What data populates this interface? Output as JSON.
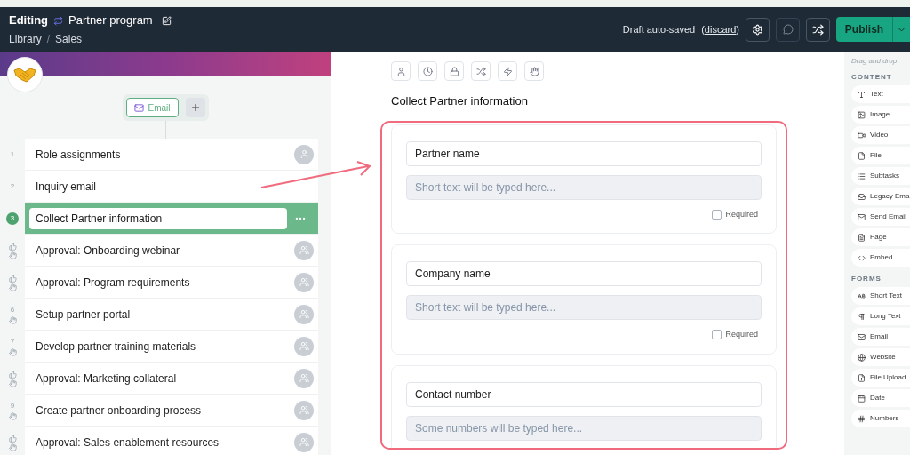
{
  "header": {
    "mode": "Editing",
    "title": "Partner program",
    "breadcrumb": [
      "Library",
      "Sales"
    ],
    "breadcrumb_separator": "/",
    "save_status": "Draft auto-saved",
    "discard_open": "(",
    "discard_link": "discard",
    "discard_close": ")",
    "publish_button": "Publish"
  },
  "workflow": {
    "trigger_chip": "Email",
    "steps": [
      {
        "number": "1",
        "approval": false,
        "manual": false,
        "label": "Role assignments",
        "kind": "person",
        "selected": false
      },
      {
        "number": "2",
        "approval": false,
        "manual": false,
        "label": "Inquiry email",
        "kind": "plain",
        "selected": false
      },
      {
        "number": "3",
        "approval": false,
        "manual": false,
        "label": "Collect Partner information",
        "kind": "plain",
        "selected": true
      },
      {
        "approval": true,
        "manual": true,
        "label": "Approval: Onboarding webinar",
        "kind": "group",
        "selected": false
      },
      {
        "approval": true,
        "manual": true,
        "label": "Approval: Program requirements",
        "kind": "group",
        "selected": false
      },
      {
        "number": "6",
        "approval": false,
        "manual": true,
        "label": "Setup partner portal",
        "kind": "group",
        "selected": false
      },
      {
        "number": "7",
        "approval": false,
        "manual": true,
        "label": "Develop partner training materials",
        "kind": "group",
        "selected": false
      },
      {
        "approval": true,
        "manual": true,
        "label": "Approval: Marketing collateral",
        "kind": "group",
        "selected": false
      },
      {
        "number": "9",
        "approval": false,
        "manual": true,
        "label": "Create partner onboarding process",
        "kind": "group",
        "selected": false
      },
      {
        "approval": true,
        "manual": true,
        "label": "Approval: Sales enablement resources",
        "kind": "group",
        "selected": false
      }
    ]
  },
  "editor": {
    "title": "Collect Partner information",
    "fields": [
      {
        "label": "Partner name",
        "placeholder": "Short text will be typed here...",
        "required": {
          "label": "Required",
          "checked": false
        }
      },
      {
        "label": "Company name",
        "placeholder": "Short text will be typed here...",
        "required": {
          "label": "Required",
          "checked": false
        }
      },
      {
        "label": "Contact number",
        "placeholder": "Some numbers will be typed here..."
      }
    ]
  },
  "palette": {
    "hint": "Drag and drop",
    "sections": [
      {
        "heading": "CONTENT",
        "items": [
          {
            "kind": "text",
            "label": "Text"
          },
          {
            "kind": "image",
            "label": "Image"
          },
          {
            "kind": "video",
            "label": "Video"
          },
          {
            "kind": "file",
            "label": "File"
          },
          {
            "kind": "subtasks",
            "label": "Subtasks"
          },
          {
            "kind": "legacy-email",
            "label": "Legacy Ema"
          },
          {
            "kind": "email",
            "label": "Send Email"
          },
          {
            "kind": "page",
            "label": "Page"
          },
          {
            "kind": "embed",
            "label": "Embed"
          }
        ]
      },
      {
        "heading": "FORMS",
        "items": [
          {
            "kind": "short-text",
            "label": "Short Text"
          },
          {
            "kind": "long-text",
            "label": "Long Text"
          },
          {
            "kind": "email",
            "label": "Email"
          },
          {
            "kind": "website",
            "label": "Website"
          },
          {
            "kind": "file-upload",
            "label": "File Upload"
          },
          {
            "kind": "date",
            "label": "Date"
          },
          {
            "kind": "numbers",
            "label": "Numbers"
          }
        ]
      }
    ]
  }
}
